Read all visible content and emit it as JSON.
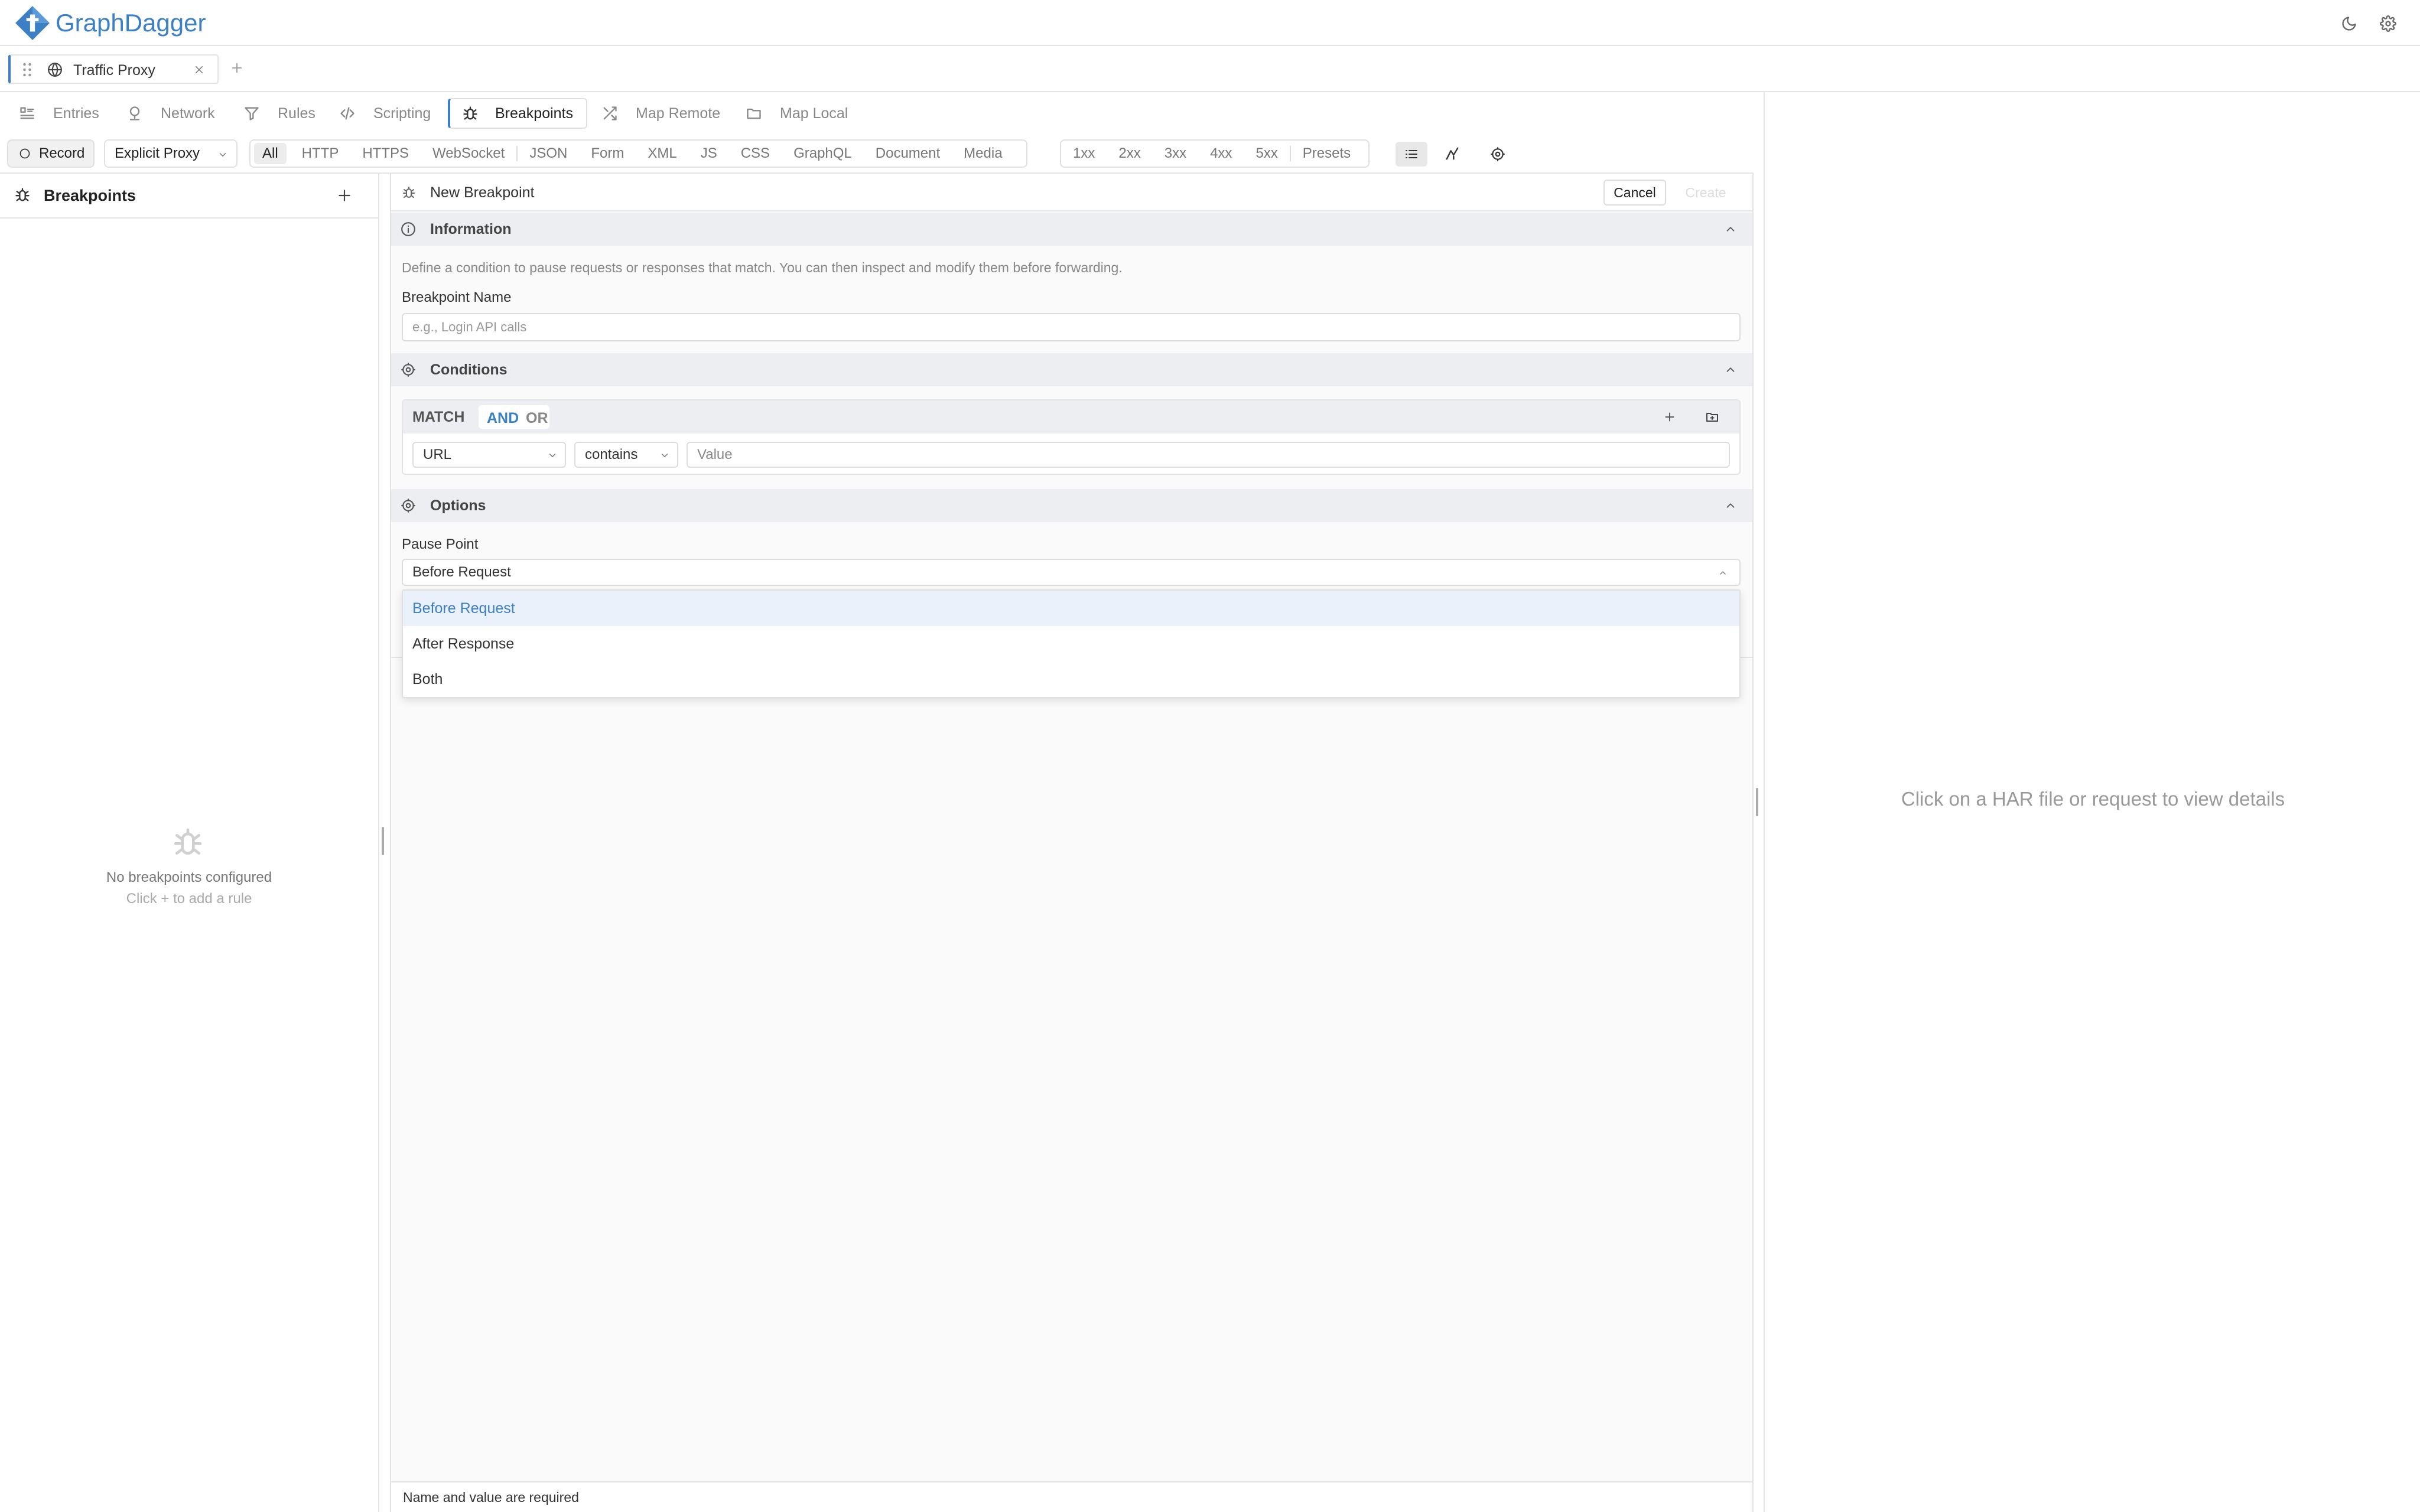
{
  "app": {
    "name": "GraphDagger",
    "brand_color": "#3b7fc4"
  },
  "topbar": {
    "moon_icon": "moon-icon",
    "settings_icon": "gear-icon"
  },
  "tabs": [
    {
      "label": "Traffic Proxy",
      "icon": "globe-icon"
    }
  ],
  "nav": {
    "items": [
      {
        "label": "Entries",
        "icon": "list-icon"
      },
      {
        "label": "Network",
        "icon": "network-icon"
      },
      {
        "label": "Rules",
        "icon": "filter-icon"
      },
      {
        "label": "Scripting",
        "icon": "code-icon"
      },
      {
        "label": "Breakpoints",
        "icon": "bug-icon",
        "active": true
      },
      {
        "label": "Map Remote",
        "icon": "shuffle-icon"
      },
      {
        "label": "Map Local",
        "icon": "folder-icon"
      }
    ]
  },
  "toolbar": {
    "record_label": "Record",
    "proxy_mode": "Explicit Proxy",
    "type_filters": [
      "All",
      "HTTP",
      "HTTPS",
      "WebSocket",
      "JSON",
      "Form",
      "XML",
      "JS",
      "CSS",
      "GraphQL",
      "Document",
      "Media"
    ],
    "status_filters": [
      "1xx",
      "2xx",
      "3xx",
      "4xx",
      "5xx",
      "Presets"
    ]
  },
  "sidebar": {
    "title": "Breakpoints",
    "empty_title": "No breakpoints configured",
    "empty_hint": "Click + to add a rule"
  },
  "editor": {
    "title": "New Breakpoint",
    "cancel_label": "Cancel",
    "create_label": "Create",
    "information": {
      "heading": "Information",
      "description": "Define a condition to pause requests or responses that match. You can then inspect and modify them before forwarding.",
      "name_label": "Breakpoint Name",
      "name_placeholder": "e.g., Login API calls"
    },
    "conditions": {
      "heading": "Conditions",
      "match_label": "MATCH",
      "and_label": "AND",
      "or_label": "OR",
      "field_value": "URL",
      "operator_value": "contains",
      "value_placeholder": "Value"
    },
    "options": {
      "heading": "Options",
      "pause_label": "Pause Point",
      "pause_value": "Before Request",
      "dropdown_options": [
        "Before Request",
        "After Response",
        "Both"
      ]
    },
    "status": "Name and value are required"
  },
  "details": {
    "placeholder": "Click on a HAR file or request to view details"
  }
}
